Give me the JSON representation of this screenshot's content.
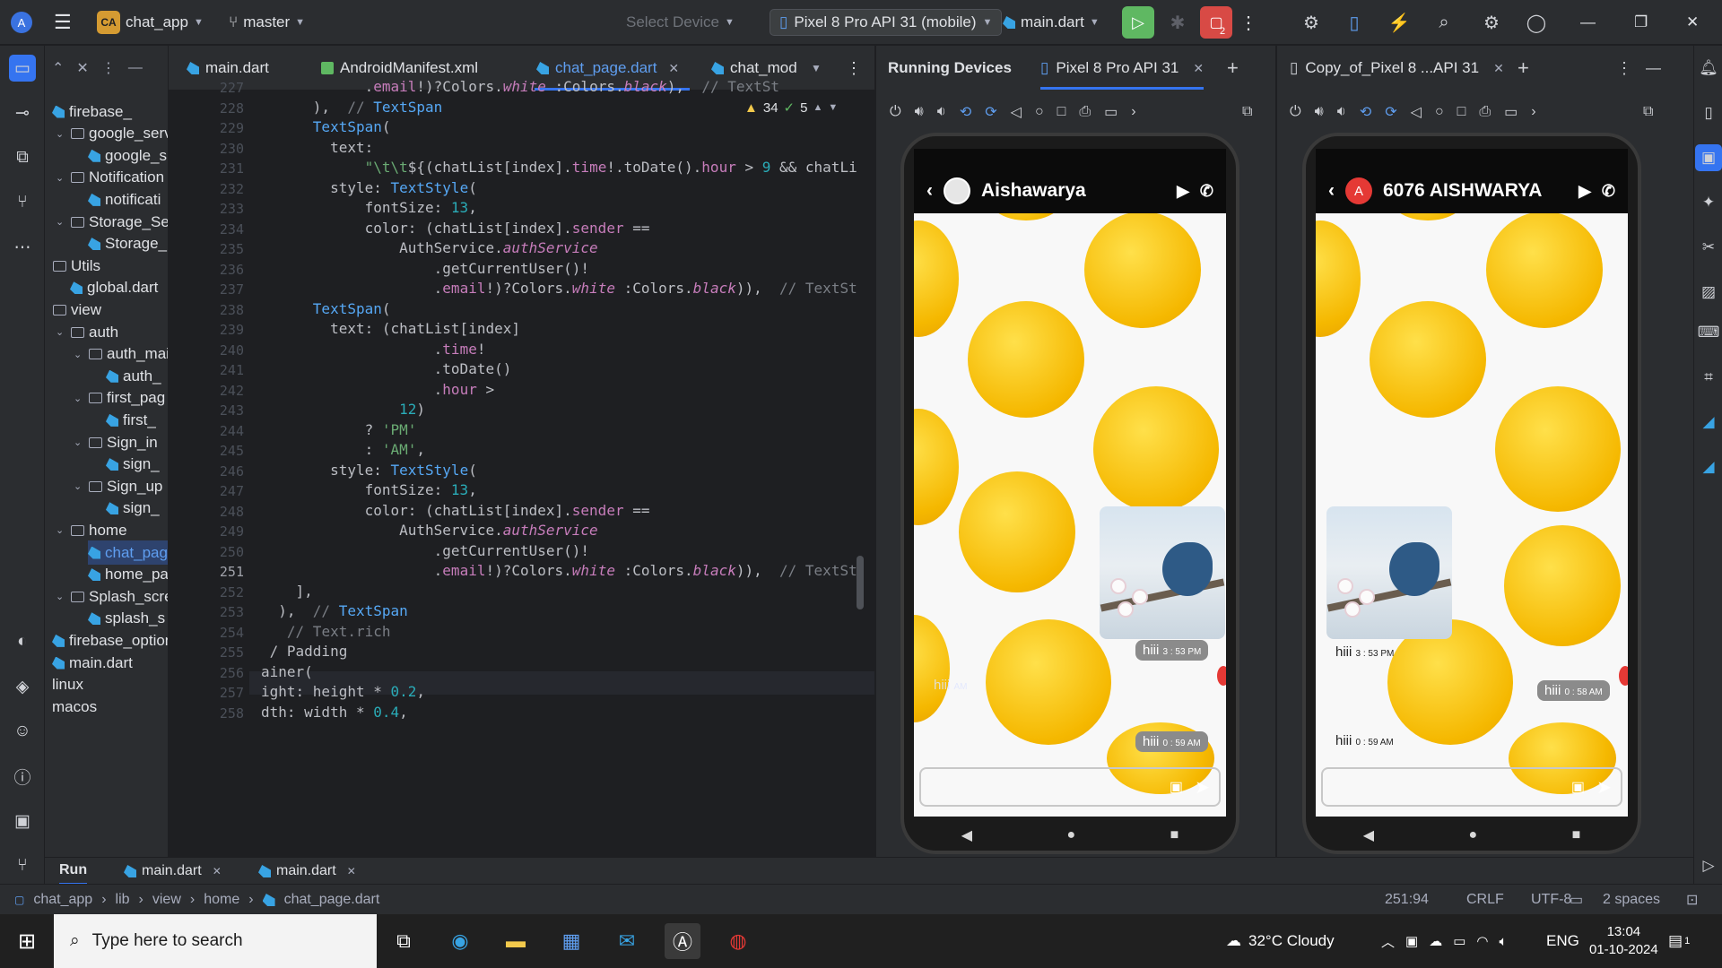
{
  "topbar": {
    "project_badge": "CA",
    "project": "chat_app",
    "branch": "master",
    "select_device": "Select Device",
    "device": "Pixel 8 Pro API 31 (mobile)",
    "run_config": "main.dart",
    "badge_count": "2"
  },
  "project_tree": [
    {
      "label": "firebase_",
      "type": "dart",
      "indent": 0
    },
    {
      "label": "google_serv",
      "type": "folder",
      "indent": 1
    },
    {
      "label": "google_s",
      "type": "dart",
      "indent": 2
    },
    {
      "label": "Notification",
      "type": "folder",
      "indent": 1
    },
    {
      "label": "notificati",
      "type": "dart",
      "indent": 2
    },
    {
      "label": "Storage_Ser",
      "type": "folder",
      "indent": 1
    },
    {
      "label": "Storage_",
      "type": "dart",
      "indent": 2
    },
    {
      "label": "Utils",
      "type": "folder",
      "indent": 0
    },
    {
      "label": "global.dart",
      "type": "dart",
      "indent": 1
    },
    {
      "label": "view",
      "type": "folder",
      "indent": 0
    },
    {
      "label": "auth",
      "type": "folder",
      "indent": 1
    },
    {
      "label": "auth_mai",
      "type": "folder",
      "indent": 2
    },
    {
      "label": "auth_",
      "type": "dart",
      "indent": 3
    },
    {
      "label": "first_pag",
      "type": "folder",
      "indent": 2
    },
    {
      "label": "first_",
      "type": "dart",
      "indent": 3
    },
    {
      "label": "Sign_in",
      "type": "folder",
      "indent": 2
    },
    {
      "label": "sign_",
      "type": "dart",
      "indent": 3
    },
    {
      "label": "Sign_up",
      "type": "folder",
      "indent": 2
    },
    {
      "label": "sign_",
      "type": "dart",
      "indent": 3
    },
    {
      "label": "home",
      "type": "folder",
      "indent": 1
    },
    {
      "label": "chat_pag",
      "type": "dart",
      "indent": 2,
      "selected": true
    },
    {
      "label": "home_pa",
      "type": "dart",
      "indent": 2
    },
    {
      "label": "Splash_scre",
      "type": "folder",
      "indent": 1
    },
    {
      "label": "splash_s",
      "type": "dart",
      "indent": 2
    },
    {
      "label": "firebase_option",
      "type": "dart",
      "indent": 0
    },
    {
      "label": "main.dart",
      "type": "dart",
      "indent": 0
    },
    {
      "label": "linux",
      "type": "plain",
      "indent": 0
    },
    {
      "label": "macos",
      "type": "plain",
      "indent": 0
    }
  ],
  "editor_tabs": [
    {
      "label": "main.dart",
      "type": "dart"
    },
    {
      "label": "AndroidManifest.xml",
      "type": "xml"
    },
    {
      "label": "chat_page.dart",
      "type": "dart",
      "active": true
    },
    {
      "label": "chat_mod",
      "type": "dart"
    }
  ],
  "inspections": {
    "warnings": "34",
    "weak": "5"
  },
  "line_numbers": [
    "227",
    "228",
    "229",
    "230",
    "231",
    "232",
    "233",
    "234",
    "235",
    "236",
    "237",
    "238",
    "239",
    "240",
    "241",
    "242",
    "243",
    "244",
    "245",
    "246",
    "247",
    "248",
    "249",
    "250",
    "251",
    "252",
    "253",
    "254",
    "255",
    "256",
    "257",
    "258"
  ],
  "code_lines": [
    "            .email!)?Colors.white :Colors.black),  // TextSt",
    "      ),  // TextSpan",
    "      TextSpan(",
    "        text:",
    "            \"\\t\\t${(chatList[index].time!.toDate().hour > 9 && chatLi",
    "        style: TextStyle(",
    "            fontSize: 13,",
    "            color: (chatList[index].sender ==",
    "                AuthService.authService",
    "                    .getCurrentUser()!",
    "                    .email!)?Colors.white :Colors.black)),  // TextSt",
    "      TextSpan(",
    "        text: (chatList[index]",
    "                    .time!",
    "                    .toDate()",
    "                    .hour >",
    "                12)",
    "            ? 'PM'",
    "            : 'AM',",
    "        style: TextStyle(",
    "            fontSize: 13,",
    "            color: (chatList[index].sender ==",
    "                AuthService.authService",
    "                    .getCurrentUser()!",
    "                    .email!)?Colors.white :Colors.black)),  // TextSt",
    "    ],",
    "  ),  // TextSpan",
    "   // Text.rich",
    " / Padding",
    "ainer(",
    "ight: height * 0.2,",
    "dth: width * 0.4,"
  ],
  "running_devices": {
    "title": "Running Devices",
    "tab1": "Pixel 8 Pro API 31",
    "tab2": "Copy_of_Pixel 8 ...API 31"
  },
  "phone1": {
    "contact": "Aishawarya",
    "msg1_text": "hiii",
    "msg1_time": "3 : 53 PM",
    "msg2_text": "hiii",
    "msg2_time": "0 : 59 AM",
    "faded_text": "hiii",
    "faded_time": "AM"
  },
  "phone2": {
    "avatar": "A",
    "contact": "6076 AISHWARYA",
    "msg1_text": "hiii",
    "msg1_time": "3 : 53 PM",
    "msg2_text": "hiii",
    "msg2_time": "0 : 58 AM",
    "msg3_text": "hiii",
    "msg3_time": "0 : 59 AM"
  },
  "runbar": {
    "run": "Run",
    "tab1": "main.dart",
    "tab2": "main.dart"
  },
  "statusbar": {
    "breadcrumb": [
      "chat_app",
      "lib",
      "view",
      "home",
      "chat_page.dart"
    ],
    "position": "251:94",
    "line_sep": "CRLF",
    "encoding": "UTF-8",
    "indent": "2 spaces"
  },
  "taskbar": {
    "search_placeholder": "Type here to search",
    "weather": "32°C  Cloudy",
    "lang": "ENG",
    "time": "13:04",
    "date": "01-10-2024",
    "notif": "1"
  }
}
